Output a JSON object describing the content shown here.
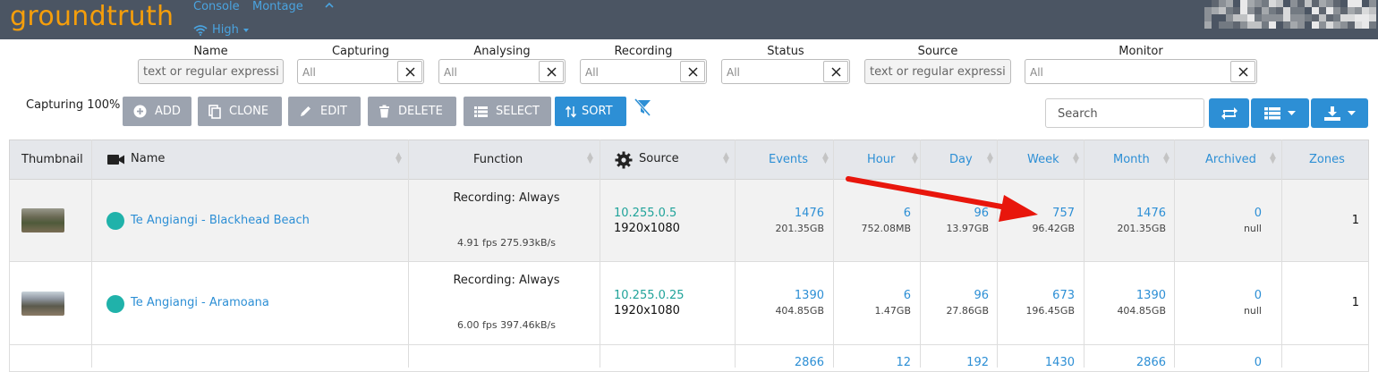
{
  "navbar": {
    "brand": "groundtruth",
    "links": [
      "Console",
      "Montage"
    ],
    "bandwidth": "High"
  },
  "filters": [
    {
      "label": "Name",
      "placeholder": "text or regular expressi",
      "type": "text"
    },
    {
      "label": "Capturing",
      "placeholder": "All",
      "type": "select"
    },
    {
      "label": "Analysing",
      "placeholder": "All",
      "type": "select"
    },
    {
      "label": "Recording",
      "placeholder": "All",
      "type": "select"
    },
    {
      "label": "Status",
      "placeholder": "All",
      "type": "select"
    },
    {
      "label": "Source",
      "placeholder": "text or regular expressi",
      "type": "text"
    },
    {
      "label": "Monitor",
      "placeholder": "All",
      "type": "select"
    }
  ],
  "toolbar": {
    "capturing_label": "Capturing 100%",
    "add": "ADD",
    "clone": "CLONE",
    "edit": "EDIT",
    "delete": "DELETE",
    "select": "SELECT",
    "sort": "SORT",
    "search_placeholder": "Search"
  },
  "columns": {
    "thumbnail": "Thumbnail",
    "name": "Name",
    "function": "Function",
    "source": "Source",
    "events": "Events",
    "hour": "Hour",
    "day": "Day",
    "week": "Week",
    "month": "Month",
    "archived": "Archived",
    "zones": "Zones"
  },
  "rows": [
    {
      "name": "Te Angiangi - Blackhead Beach",
      "function": "Recording: Always",
      "fps": "4.91 fps 275.93kB/s",
      "ip": "10.255.0.5",
      "resolution": "1920x1080",
      "events": "1476",
      "events_size": "201.35GB",
      "hour": "6",
      "hour_size": "752.08MB",
      "day": "96",
      "day_size": "13.97GB",
      "week": "757",
      "week_size": "96.42GB",
      "month": "1476",
      "month_size": "201.35GB",
      "archived": "0",
      "archived_size": "null",
      "zones": "1"
    },
    {
      "name": "Te Angiangi - Aramoana",
      "function": "Recording: Always",
      "fps": "6.00 fps 397.46kB/s",
      "ip": "10.255.0.25",
      "resolution": "1920x1080",
      "events": "1390",
      "events_size": "404.85GB",
      "hour": "6",
      "hour_size": "1.47GB",
      "day": "96",
      "day_size": "27.86GB",
      "week": "673",
      "week_size": "196.45GB",
      "month": "1390",
      "month_size": "404.85GB",
      "archived": "0",
      "archived_size": "null",
      "zones": "1"
    }
  ],
  "totals": {
    "events": "2866",
    "hour": "12",
    "day": "192",
    "week": "1430",
    "month": "2866",
    "archived": "0"
  },
  "colors": {
    "navbar": "#4b5563",
    "brand": "#f59e0b",
    "link": "#2d8fd5",
    "status_dot": "#20b2aa",
    "annotation_arrow": "#e8160c"
  }
}
